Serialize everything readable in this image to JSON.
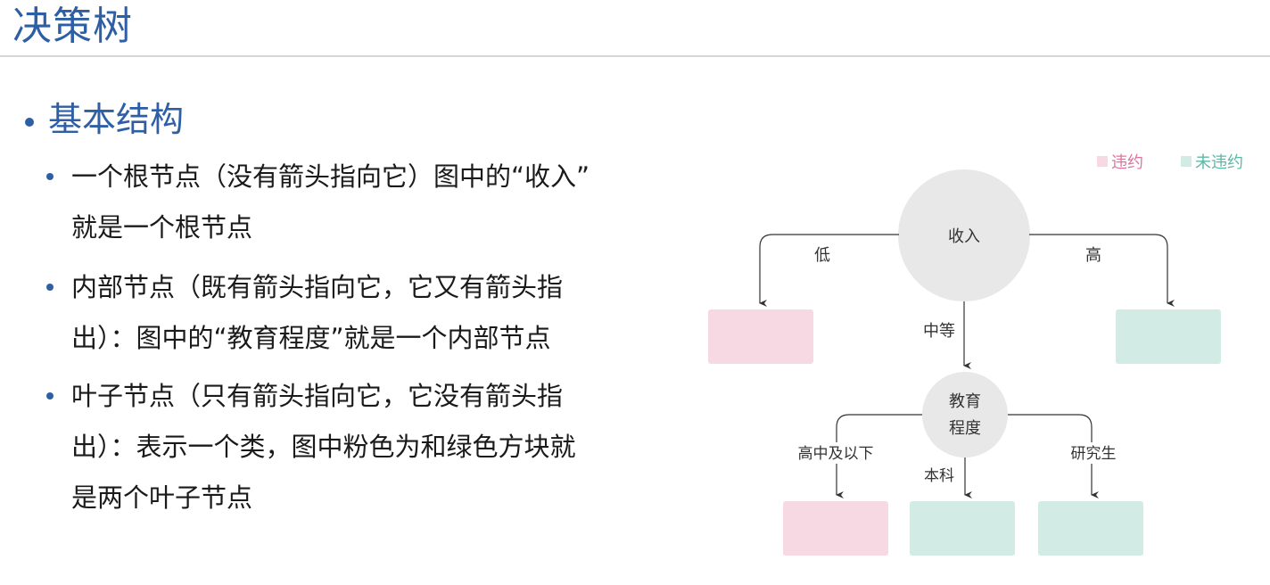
{
  "slide": {
    "title": "决策树",
    "section_heading": "基本结构",
    "bullets": [
      {
        "lines": [
          "一个根节点（没有箭头指向它）图中的“收入”",
          "就是一个根节点"
        ]
      },
      {
        "lines": [
          "内部节点（既有箭头指向它，它又有箭头指",
          "出）：图中的“教育程度”就是一个内部节点"
        ]
      },
      {
        "lines": [
          "叶子节点（只有箭头指向它，它没有箭头指",
          "出）：表示一个类，图中粉色为和绿色方块就",
          "是两个叶子节点"
        ]
      }
    ]
  },
  "diagram": {
    "legend": {
      "default_label": "违约",
      "non_default_label": "未违约",
      "default_color": "#f7d9e4",
      "non_default_color": "#d2ebe5"
    },
    "root": {
      "label": "收入"
    },
    "internal": {
      "label_line1": "教育",
      "label_line2": "程度"
    },
    "edges": {
      "low": "低",
      "mid": "中等",
      "high": "高",
      "highschool": "高中及以下",
      "bachelor": "本科",
      "graduate": "研究生"
    },
    "colors": {
      "node_fill": "#e8e8e8",
      "pink_text": "#e0749c",
      "teal_text": "#5cb8a6",
      "accent": "#2e5fa5"
    }
  }
}
